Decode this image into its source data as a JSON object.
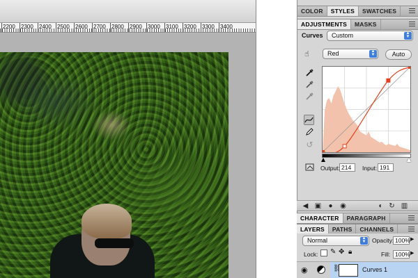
{
  "ruler": {
    "labels": [
      "2200",
      "2300",
      "2400",
      "2500",
      "2600",
      "2700",
      "2800",
      "2900",
      "3000",
      "3100",
      "3200",
      "3300",
      "3400"
    ]
  },
  "tabs_top": [
    "COLOR",
    "STYLES",
    "SWATCHES"
  ],
  "adjustments": {
    "tabs": [
      "ADJUSTMENTS",
      "MASKS"
    ],
    "type_label": "Curves",
    "preset_value": "Custom",
    "channel_value": "Red",
    "auto_label": "Auto",
    "output_label": "Output:",
    "output_value": "214",
    "input_label": "Input:",
    "input_value": "191"
  },
  "curve": {
    "channel_color": "#e8401c",
    "points": [
      [
        0,
        0
      ],
      [
        64,
        18
      ],
      [
        191,
        214
      ],
      [
        255,
        255
      ]
    ]
  },
  "character_tabs": [
    "CHARACTER",
    "PARAGRAPH"
  ],
  "layers": {
    "tabs": [
      "LAYERS",
      "PATHS",
      "CHANNELS"
    ],
    "blend_mode": "Normal",
    "opacity_label": "Opacity:",
    "opacity_value": "100%",
    "lock_label": "Lock:",
    "fill_label": "Fill:",
    "fill_value": "100%",
    "layer_name": "Curves 1"
  },
  "colors": {
    "accent_blue": "#3d7ee0",
    "selection_blue": "#b9d3f3",
    "histogram": "#f3c2ad"
  }
}
